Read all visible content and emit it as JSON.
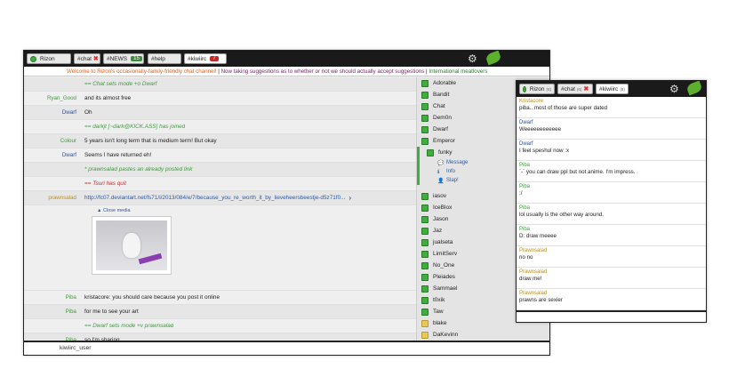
{
  "main": {
    "tabs": [
      {
        "label": "Rizon",
        "type": "network"
      },
      {
        "label": "#chat",
        "type": "channel",
        "close": "close-icon"
      },
      {
        "label": "#NEWS",
        "type": "channel",
        "count": "15"
      },
      {
        "label": "#help",
        "type": "channel"
      },
      {
        "label": "#kiwiirc",
        "type": "channel",
        "count": "7",
        "active": true
      }
    ],
    "topic": {
      "part1": "Welcome to Rizon's occasionally-family-friendly chat channel!",
      "sep1": " | ",
      "part2": "Now taking suggestions as to whether or not we should actually accept suggestions",
      "sep2": " | ",
      "part3": "International meatlovers"
    },
    "messages": [
      {
        "nick": "",
        "text": "== Chat sets mode +o Dwarf",
        "style": "green",
        "nick_color": ""
      },
      {
        "nick": "Ryan_Good",
        "text": "and its almost free",
        "style": "",
        "nick_color": "ryan"
      },
      {
        "nick": "Dwarf",
        "text": "Oh",
        "style": "",
        "nick_color": "dwarf"
      },
      {
        "nick": "",
        "text": "== darkjt [~dark@KICK.ASS] has joined",
        "style": "green",
        "nick_color": ""
      },
      {
        "nick": "Colour",
        "text": "5 years isn't long term that is medium term! But okay",
        "style": "",
        "nick_color": "colour"
      },
      {
        "nick": "Dwarf",
        "text": "Seems I have returned eh!",
        "style": "",
        "nick_color": "dwarf"
      },
      {
        "nick": "",
        "text": "* prawnsalad  pastes an already posted link",
        "style": "green",
        "nick_color": ""
      },
      {
        "nick": "",
        "text": "== Tsuri has quit",
        "style": "red",
        "nick_color": ""
      },
      {
        "nick": "prawnsalad",
        "text": "http://fc07.deviantart.net/fs71/i/2013/084/e/7/because_you_re_worth_it_by_lieveheersbeestje-d5z71f0...",
        "style": "link",
        "nick_color": "prawn"
      }
    ],
    "media_close": "Close media",
    "messages_after": [
      {
        "nick": "Piba",
        "text": "kristacore:  you should care because you post it online",
        "style": "",
        "nick_color": "piba"
      },
      {
        "nick": "Piba",
        "text": "for me to see your art",
        "style": "",
        "nick_color": "piba"
      },
      {
        "nick": "",
        "text": "== Dwarf sets mode +v prawnsalad",
        "style": "green",
        "nick_color": ""
      },
      {
        "nick": "Piba",
        "text": "so I'm sharing",
        "style": "",
        "nick_color": "piba"
      }
    ],
    "input_nick": "kiwiirc_user",
    "users": [
      "Adorable",
      "Bandit",
      "Chat",
      "Dem0n",
      "Dwarf",
      "Emperor",
      "funky"
    ],
    "user_actions": [
      "Message",
      "Info",
      "Slap!"
    ],
    "users2": [
      "iasov",
      "IceBlox",
      "Jason",
      "Jaz",
      "jualseta",
      "LimitServ",
      "No_One",
      "Pleiades",
      "Sammael",
      "t0xik",
      "Taw",
      "blake",
      "DaKevinn"
    ]
  },
  "popup": {
    "tabs": [
      {
        "label": "Rizon",
        "count": "(6)"
      },
      {
        "label": "#chat",
        "count": "(6)",
        "close": "close-icon"
      },
      {
        "label": "#kiwiirc",
        "count": "(6)"
      }
    ],
    "messages": [
      {
        "nick": "Kristacore",
        "text": "piba.. most of those are super dated",
        "nick_color": "krista"
      },
      {
        "nick": "Dwarf",
        "text": "Weeeeeeeeeeee",
        "nick_color": "dwarf"
      },
      {
        "nick": "Dwarf",
        "text": "I feel speshul now :x",
        "nick_color": "dwarf"
      },
      {
        "nick": "Piba",
        "text": "`-` you can draw ppl but not anime. I'm impress.",
        "nick_color": "piba"
      },
      {
        "nick": "Piba",
        "text": ":/",
        "nick_color": "piba"
      },
      {
        "nick": "Piba",
        "text": "lol usually is the other way around.",
        "nick_color": "piba"
      },
      {
        "nick": "Piba",
        "text": "D: draw meeee",
        "nick_color": "piba"
      },
      {
        "nick": "Prawnsalad",
        "text": "no no",
        "nick_color": "prawn"
      },
      {
        "nick": "Prawnsalad",
        "text": "draw me!",
        "nick_color": "prawn"
      },
      {
        "nick": "Prawnsalad",
        "text": "prawns are sexier",
        "nick_color": "prawn"
      }
    ]
  },
  "icons": {
    "settings": "gear-icon",
    "logo": "kiwi-leaf-icon",
    "status": "green-dot-icon"
  }
}
